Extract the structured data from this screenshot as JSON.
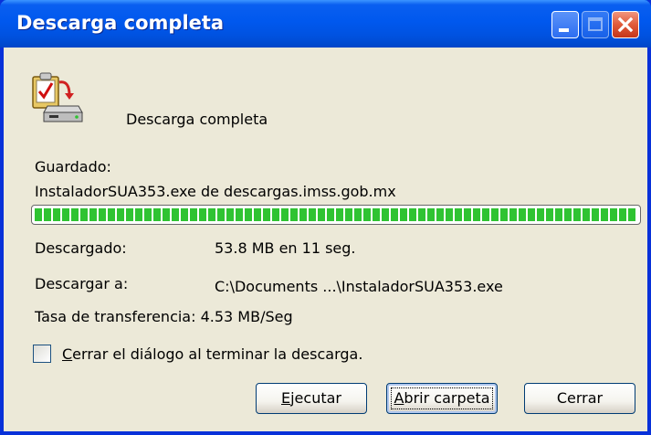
{
  "window": {
    "title": "Descarga completa"
  },
  "dialog": {
    "heading": "Descarga completa",
    "saved_label": "Guardado:",
    "saved_value": "InstaladorSUA353.exe de descargas.imss.gob.mx",
    "progress_percent": 100,
    "downloaded_label": "Descargado:",
    "downloaded_value": "53.8 MB en 11 seg.",
    "download_to_label": "Descargar a:",
    "download_to_value": "C:\\Documents ...\\InstaladorSUA353.exe",
    "transfer_rate_text": "Tasa de transferencia: 4.53 MB/Seg",
    "close_checkbox": {
      "checked": false,
      "mnemonic": "C",
      "label_rest": "errar el diálogo al terminar la descarga."
    }
  },
  "buttons": {
    "run": {
      "mnemonic": "E",
      "rest": "jecutar"
    },
    "open_folder": {
      "mnemonic": "A",
      "rest": "brir carpeta"
    },
    "close": {
      "label": "Cerrar"
    }
  },
  "colors": {
    "titlebar": "#0058ee",
    "progress_fill": "#2fc332",
    "dialog_bg": "#ece9d8"
  },
  "icons": {
    "app": "download-clipboard-icon",
    "minimize": "minimize-icon",
    "maximize": "maximize-icon",
    "close": "close-icon"
  }
}
